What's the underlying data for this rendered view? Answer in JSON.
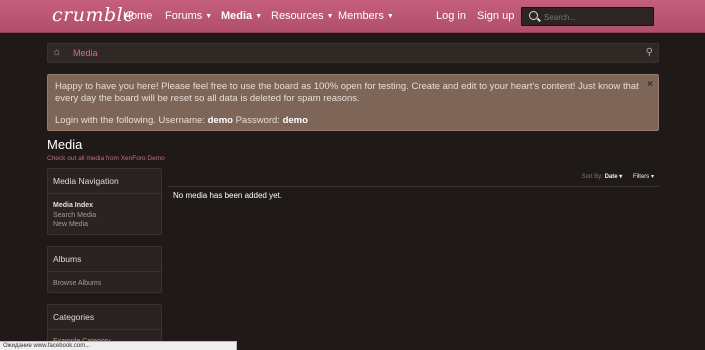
{
  "header": {
    "logo": "crumble",
    "nav": [
      {
        "label": "Home",
        "dropdown": false
      },
      {
        "label": "Forums",
        "dropdown": true
      },
      {
        "label": "Media",
        "dropdown": true,
        "active": true
      },
      {
        "label": "Resources",
        "dropdown": true
      },
      {
        "label": "Members",
        "dropdown": true
      }
    ],
    "login": "Log in",
    "signup": "Sign up",
    "search_placeholder": "Search..."
  },
  "breadcrumb": {
    "current": "Media"
  },
  "notice": {
    "line1": "Happy to have you here! Please feel free to use the board as 100% open for testing. Create and edit to your heart's content! Just know that every day the board will be reset so all data is deleted for spam reasons.",
    "login_prefix": "Login with the following. Username: ",
    "username": "demo",
    "password_label": " Password: ",
    "password": "demo",
    "close": "×"
  },
  "page": {
    "title": "Media",
    "description": "Check out all media from XenForo Demo"
  },
  "sidebar": {
    "navigation": {
      "title": "Media Navigation",
      "items": [
        "Media Index",
        "Search Media",
        "New Media"
      ]
    },
    "albums": {
      "title": "Albums",
      "items": [
        "Browse Albums"
      ]
    },
    "categories": {
      "title": "Categories",
      "items": [
        "Example Category"
      ]
    }
  },
  "content": {
    "sort_label": "Sort By:",
    "sort_value": "Date",
    "filters": "Filters",
    "empty_message": "No media has been added yet."
  },
  "status_bar": "Ожидание www.facebook.com..."
}
